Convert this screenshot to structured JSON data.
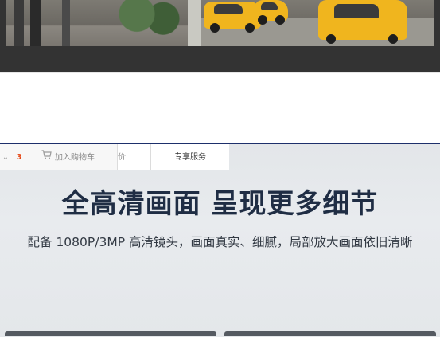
{
  "tabs": {
    "dropdown_glyph": "⌄",
    "marker_text": "3",
    "cart_label": "加入购物车",
    "price_label": "价",
    "service_label": "专享服务"
  },
  "feature": {
    "headline": "全高清画面 呈现更多细节",
    "description": "配备 1080P/3MP 高清镜头，画面真实、细腻，局部放大画面依旧清晰"
  },
  "colors": {
    "headline": "#1f2d44",
    "band": "#333333",
    "section_bg": "#e5e8eb",
    "accent_line": "#1d2f6b"
  }
}
